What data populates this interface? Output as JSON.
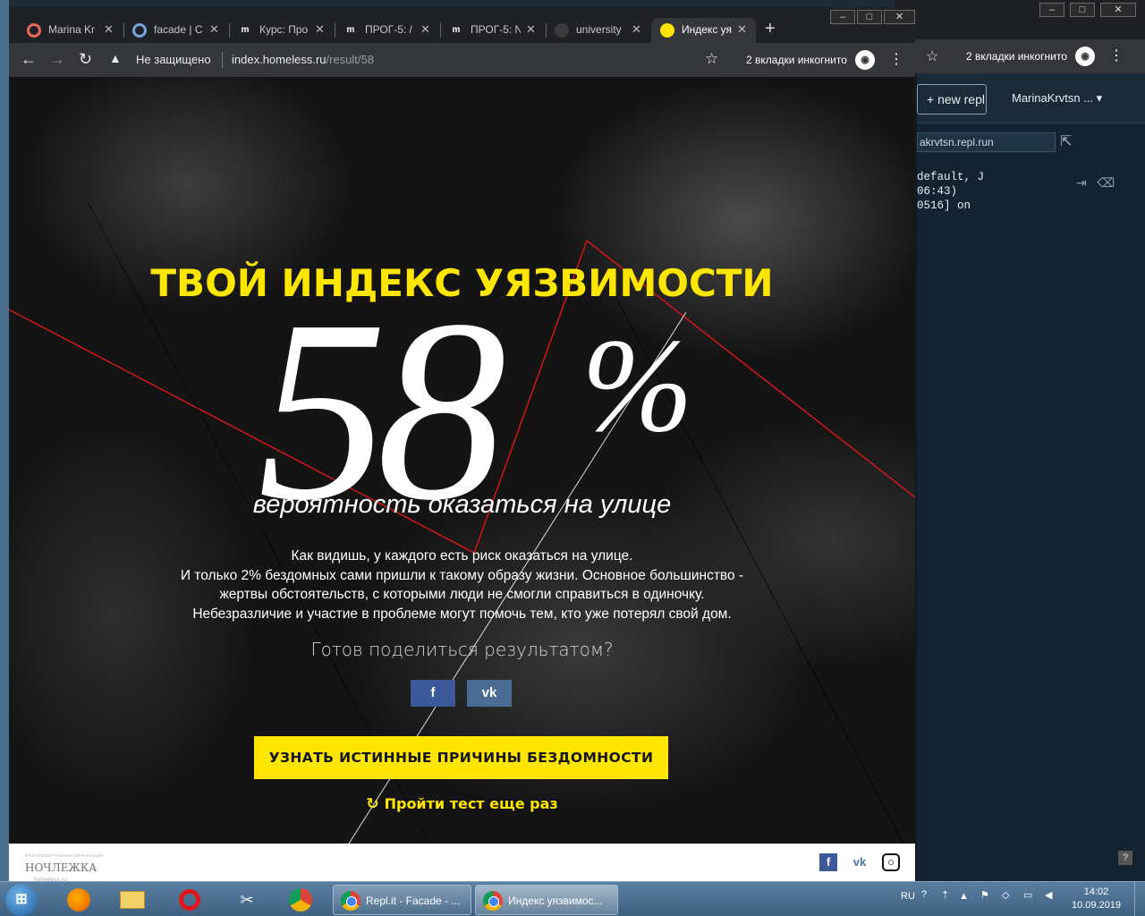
{
  "background_window": {
    "toolbar_incognito": "2 вкладки инкогнито",
    "new_repl_label": "+ new repl",
    "user_menu": "MarinaKrvtsn ... ▾",
    "repl_url": "akrvtsn.repl.run",
    "console_lines": [
      "default, J",
      "06:43)",
      "0516] on"
    ]
  },
  "browser": {
    "tabs": [
      {
        "title": "Marina Kr",
        "fav": "o",
        "fav_color": "#e46a5f"
      },
      {
        "title": "facade | C",
        "fav": "o",
        "fav_color": "#e46a5f"
      },
      {
        "title": "Курс: Про",
        "fav": "m",
        "fav_color": "#ffffff"
      },
      {
        "title": "ПРОГ-5: /",
        "fav": "m",
        "fav_color": "#ffffff"
      },
      {
        "title": "ПРОГ-5: N",
        "fav": "m",
        "fav_color": "#ffffff"
      },
      {
        "title": "university",
        "fav": "●",
        "fav_color": "#333333"
      },
      {
        "title": "Индекс уя",
        "fav": "●",
        "fav_color": "#ffe600"
      }
    ],
    "not_secure": "Не защищено",
    "url_host": "index.homeless.ru",
    "url_path": "/result/58",
    "incognito_text": "2 вкладки инкогнито"
  },
  "page": {
    "heading": "ТВОЙ ИНДЕКС УЯЗВИМОСТИ",
    "big_number": "58",
    "percent_sign": "%",
    "subtitle": "вероятность оказаться на улице",
    "paragraph_lines": [
      "Как видишь, у каждого есть риск оказаться на улице.",
      "И только 2% бездомных сами пришли к такому образу жизни. Основное большинство -",
      "жертвы обстоятельств, с которыми люди не смогли справиться в одиночку.",
      "Небезразличие и участие в проблеме могут помочь тем, кто уже потерял свой дом."
    ],
    "share_question": "Готов поделиться результатом?",
    "share_fb": "f",
    "share_vk": "vk",
    "cta_label": "УЗНАТЬ ИСТИННЫЕ ПРИЧИНЫ БЕЗДОМНОСТИ",
    "retry_label": "Пройти тест еще раз",
    "accent_color": "#ffe600"
  },
  "footer": {
    "logo_pre": "благотворительная организация",
    "logo_text": "НОЧЛЕЖКА",
    "logo_site": "homeless.ru",
    "icons": [
      "facebook-icon",
      "vk-icon",
      "instagram-icon"
    ]
  },
  "taskbar": {
    "tasks": [
      {
        "label": "Repl.it - Facade - ..."
      },
      {
        "label": "Индекс уязвимос..."
      }
    ],
    "lang": "RU",
    "time": "14:02",
    "date": "10.09.2019"
  }
}
